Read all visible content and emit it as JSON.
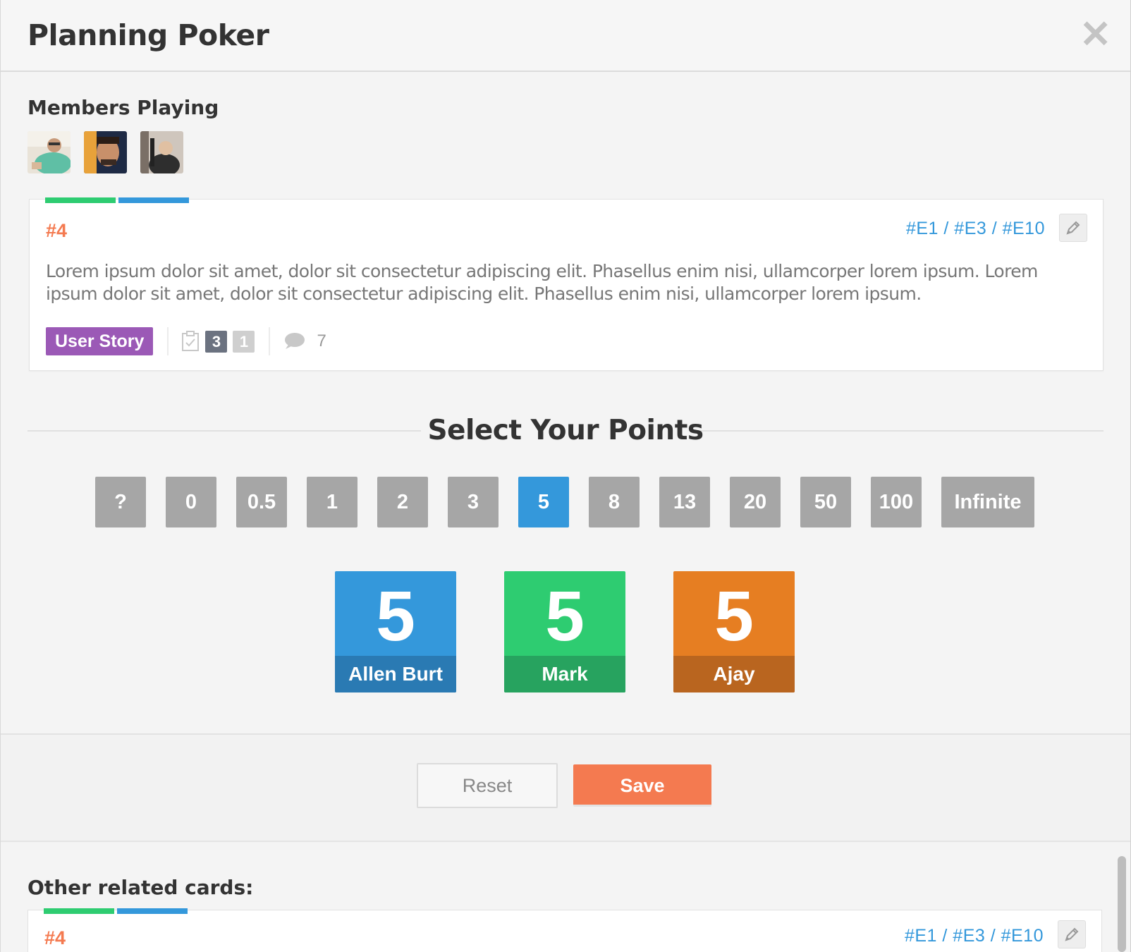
{
  "window": {
    "title": "Planning Poker"
  },
  "members": {
    "label": "Members Playing",
    "avatars": [
      "avatar-1",
      "avatar-2",
      "avatar-3"
    ]
  },
  "card": {
    "id": "#4",
    "links": "#E1 / #E3 / #E10",
    "description": "Lorem ipsum dolor sit amet, dolor sit consectetur adipiscing elit. Phasellus enim nisi, ullamcorper lorem ipsum. Lorem ipsum dolor sit amet, dolor sit consectetur adipiscing elit. Phasellus enim nisi, ullamcorper lorem ipsum.",
    "type": "User Story",
    "tasks_done": "3",
    "tasks_open": "1",
    "comments": "7",
    "label_colors": [
      "#2ecc71",
      "#3498db"
    ]
  },
  "points": {
    "title": "Select Your Points",
    "options": [
      "?",
      "0",
      "0.5",
      "1",
      "2",
      "3",
      "5",
      "8",
      "13",
      "20",
      "50",
      "100",
      "Infinite"
    ],
    "selected": "5"
  },
  "votes": [
    {
      "value": "5",
      "name": "Allen Burt",
      "color": "#3498db",
      "name_bg": "#2a7ab3"
    },
    {
      "value": "5",
      "name": "Mark",
      "color": "#2ecc71",
      "name_bg": "#27a35f"
    },
    {
      "value": "5",
      "name": "Ajay",
      "color": "#e67e22",
      "name_bg": "#b9651f"
    }
  ],
  "actions": {
    "reset": "Reset",
    "save": "Save"
  },
  "related": {
    "label": "Other related cards:",
    "cards": [
      {
        "id": "#4",
        "links": "#E1 / #E3 / #E10"
      }
    ]
  },
  "icons": {
    "close": "close-icon",
    "edit": "pencil-icon",
    "tasks": "checklist-icon",
    "comments": "comment-icon"
  }
}
